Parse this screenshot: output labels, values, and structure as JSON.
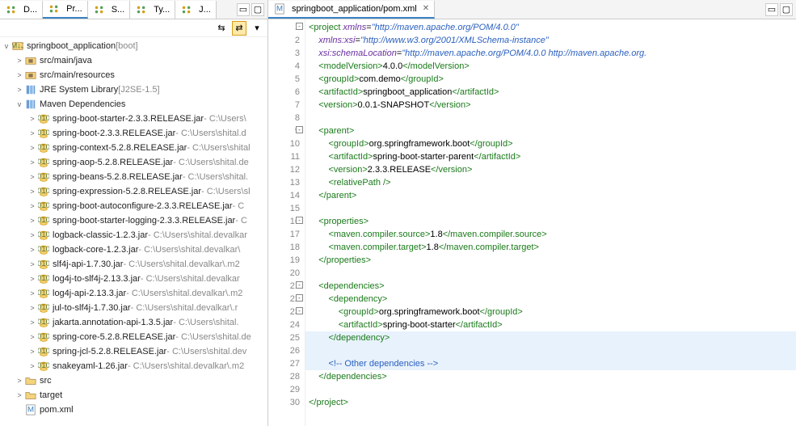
{
  "leftTabs": [
    {
      "label": "D..."
    },
    {
      "label": "Pr...",
      "active": true
    },
    {
      "label": "S..."
    },
    {
      "label": "Ty..."
    },
    {
      "label": "J..."
    }
  ],
  "project": {
    "root": {
      "label": "springboot_application",
      "suffix": " [boot]"
    },
    "items": [
      {
        "indent": 1,
        "arrow": ">",
        "iconType": "pkg",
        "label": "src/main/java"
      },
      {
        "indent": 1,
        "arrow": ">",
        "iconType": "pkg",
        "label": "src/main/resources"
      },
      {
        "indent": 1,
        "arrow": ">",
        "iconType": "lib",
        "label": "JRE System Library",
        "suffix": " [J2SE-1.5]"
      },
      {
        "indent": 1,
        "arrow": "v",
        "iconType": "lib",
        "label": "Maven Dependencies"
      },
      {
        "indent": 2,
        "arrow": ">",
        "iconType": "jar",
        "label": "spring-boot-starter-2.3.3.RELEASE.jar",
        "suffix": " - C:\\Users\\"
      },
      {
        "indent": 2,
        "arrow": ">",
        "iconType": "jar",
        "label": "spring-boot-2.3.3.RELEASE.jar",
        "suffix": " - C:\\Users\\shital.d"
      },
      {
        "indent": 2,
        "arrow": ">",
        "iconType": "jar",
        "label": "spring-context-5.2.8.RELEASE.jar",
        "suffix": " - C:\\Users\\shital"
      },
      {
        "indent": 2,
        "arrow": ">",
        "iconType": "jar",
        "label": "spring-aop-5.2.8.RELEASE.jar",
        "suffix": " - C:\\Users\\shital.de"
      },
      {
        "indent": 2,
        "arrow": ">",
        "iconType": "jar",
        "label": "spring-beans-5.2.8.RELEASE.jar",
        "suffix": " - C:\\Users\\shital."
      },
      {
        "indent": 2,
        "arrow": ">",
        "iconType": "jar",
        "label": "spring-expression-5.2.8.RELEASE.jar",
        "suffix": " - C:\\Users\\sl"
      },
      {
        "indent": 2,
        "arrow": ">",
        "iconType": "jar",
        "label": "spring-boot-autoconfigure-2.3.3.RELEASE.jar",
        "suffix": " - C"
      },
      {
        "indent": 2,
        "arrow": ">",
        "iconType": "jar",
        "label": "spring-boot-starter-logging-2.3.3.RELEASE.jar",
        "suffix": " - C"
      },
      {
        "indent": 2,
        "arrow": ">",
        "iconType": "jar",
        "label": "logback-classic-1.2.3.jar",
        "suffix": " - C:\\Users\\shital.devalkar"
      },
      {
        "indent": 2,
        "arrow": ">",
        "iconType": "jar",
        "label": "logback-core-1.2.3.jar",
        "suffix": " - C:\\Users\\shital.devalkar\\"
      },
      {
        "indent": 2,
        "arrow": ">",
        "iconType": "jar",
        "label": "slf4j-api-1.7.30.jar",
        "suffix": " - C:\\Users\\shital.devalkar\\.m2"
      },
      {
        "indent": 2,
        "arrow": ">",
        "iconType": "jar",
        "label": "log4j-to-slf4j-2.13.3.jar",
        "suffix": " - C:\\Users\\shital.devalkar"
      },
      {
        "indent": 2,
        "arrow": ">",
        "iconType": "jar",
        "label": "log4j-api-2.13.3.jar",
        "suffix": " - C:\\Users\\shital.devalkar\\.m2"
      },
      {
        "indent": 2,
        "arrow": ">",
        "iconType": "jar",
        "label": "jul-to-slf4j-1.7.30.jar",
        "suffix": " - C:\\Users\\shital.devalkar\\.r"
      },
      {
        "indent": 2,
        "arrow": ">",
        "iconType": "jar",
        "label": "jakarta.annotation-api-1.3.5.jar",
        "suffix": " - C:\\Users\\shital."
      },
      {
        "indent": 2,
        "arrow": ">",
        "iconType": "jar",
        "label": "spring-core-5.2.8.RELEASE.jar",
        "suffix": " - C:\\Users\\shital.de"
      },
      {
        "indent": 2,
        "arrow": ">",
        "iconType": "jar",
        "label": "spring-jcl-5.2.8.RELEASE.jar",
        "suffix": " - C:\\Users\\shital.dev"
      },
      {
        "indent": 2,
        "arrow": ">",
        "iconType": "jar",
        "label": "snakeyaml-1.26.jar",
        "suffix": " - C:\\Users\\shital.devalkar\\.m2"
      },
      {
        "indent": 1,
        "arrow": ">",
        "iconType": "folder",
        "label": "src"
      },
      {
        "indent": 1,
        "arrow": ">",
        "iconType": "folder",
        "label": "target"
      },
      {
        "indent": 1,
        "arrow": "",
        "iconType": "xml",
        "label": "pom.xml"
      }
    ]
  },
  "editorTab": "springboot_application/pom.xml",
  "code": [
    {
      "n": 1,
      "fold": "-",
      "html": "<span class='tag'>&lt;project</span> <span class='attr'>xmlns</span>=<span class='str'>\"http://maven.apache.org/POM/4.0.0\"</span>"
    },
    {
      "n": 2,
      "html": "    <span class='attr'>xmlns:xsi</span>=<span class='str'>\"http://www.w3.org/2001/XMLSchema-instance\"</span>"
    },
    {
      "n": 3,
      "html": "    <span class='attr'>xsi:schemaLocation</span>=<span class='str'>\"http://maven.apache.org/POM/4.0.0 http://maven.apache.org.</span>"
    },
    {
      "n": 4,
      "html": "    <span class='tag'>&lt;modelVersion&gt;</span><span class='txt'>4.0.0</span><span class='tag'>&lt;/modelVersion&gt;</span>"
    },
    {
      "n": 5,
      "html": "    <span class='tag'>&lt;groupId&gt;</span><span class='txt'>com.demo</span><span class='tag'>&lt;/groupId&gt;</span>"
    },
    {
      "n": 6,
      "html": "    <span class='tag'>&lt;artifactId&gt;</span><span class='txt'>springboot_application</span><span class='tag'>&lt;/artifactId&gt;</span>"
    },
    {
      "n": 7,
      "html": "    <span class='tag'>&lt;version&gt;</span><span class='txt'>0.0.1-SNAPSHOT</span><span class='tag'>&lt;/version&gt;</span>"
    },
    {
      "n": 8,
      "html": ""
    },
    {
      "n": 9,
      "fold": "-",
      "html": "    <span class='tag'>&lt;parent&gt;</span>"
    },
    {
      "n": 10,
      "html": "        <span class='tag'>&lt;groupId&gt;</span><span class='txt'>org.springframework.boot</span><span class='tag'>&lt;/groupId&gt;</span>"
    },
    {
      "n": 11,
      "html": "        <span class='tag'>&lt;artifactId&gt;</span><span class='txt'>spring-boot-starter-parent</span><span class='tag'>&lt;/artifactId&gt;</span>"
    },
    {
      "n": 12,
      "html": "        <span class='tag'>&lt;version&gt;</span><span class='txt'>2.3.3.RELEASE</span><span class='tag'>&lt;/version&gt;</span>"
    },
    {
      "n": 13,
      "html": "        <span class='tag'>&lt;relativePath /&gt;</span>"
    },
    {
      "n": 14,
      "html": "    <span class='tag'>&lt;/parent&gt;</span>"
    },
    {
      "n": 15,
      "html": ""
    },
    {
      "n": 16,
      "fold": "-",
      "html": "    <span class='tag'>&lt;properties&gt;</span>"
    },
    {
      "n": 17,
      "html": "        <span class='tag'>&lt;maven.compiler.source&gt;</span><span class='txt'>1.8</span><span class='tag'>&lt;/maven.compiler.source&gt;</span>"
    },
    {
      "n": 18,
      "html": "        <span class='tag'>&lt;maven.compiler.target&gt;</span><span class='txt'>1.8</span><span class='tag'>&lt;/maven.compiler.target&gt;</span>"
    },
    {
      "n": 19,
      "html": "    <span class='tag'>&lt;/properties&gt;</span>"
    },
    {
      "n": 20,
      "html": ""
    },
    {
      "n": 21,
      "fold": "-",
      "html": "    <span class='tag'>&lt;dependencies&gt;</span>"
    },
    {
      "n": 22,
      "fold": "-",
      "html": "        <span class='tag'>&lt;dependency&gt;</span>"
    },
    {
      "n": 23,
      "fold": "-",
      "html": "            <span class='tag'>&lt;groupId&gt;</span><span class='txt'>org.springframework.boot</span><span class='tag'>&lt;/groupId&gt;</span>"
    },
    {
      "n": 24,
      "html": "            <span class='tag'>&lt;artifactId&gt;</span><span class='txt'>spring-boot-starter</span><span class='tag'>&lt;/artifactId&gt;</span>"
    },
    {
      "n": 25,
      "hl": true,
      "html": "        <span class='tag'>&lt;/dependency&gt;</span>"
    },
    {
      "n": 26,
      "hl": true,
      "html": ""
    },
    {
      "n": 27,
      "hl": true,
      "html": "        <span class='cmt'>&lt;!-- Other dependencies --&gt;</span>"
    },
    {
      "n": 28,
      "html": "    <span class='tag'>&lt;/dependencies&gt;</span>"
    },
    {
      "n": 29,
      "html": ""
    },
    {
      "n": 30,
      "html": "<span class='tag'>&lt;/project&gt;</span>"
    }
  ]
}
